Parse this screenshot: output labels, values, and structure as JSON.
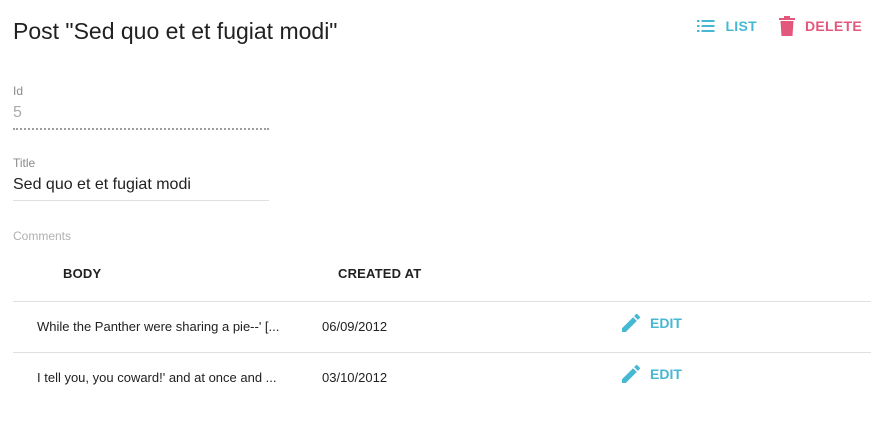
{
  "header": {
    "title": "Post \"Sed quo et et fugiat modi\"",
    "list_label": "LIST",
    "delete_label": "DELETE"
  },
  "fields": {
    "id": {
      "label": "Id",
      "value": "5"
    },
    "title": {
      "label": "Title",
      "value": "Sed quo et et fugiat modi"
    }
  },
  "comments": {
    "label": "Comments",
    "columns": {
      "body": "BODY",
      "created_at": "CREATED AT"
    },
    "rows": [
      {
        "body": "While the Panther were sharing a pie--' [...",
        "created_at": "06/09/2012",
        "edit_label": "EDIT"
      },
      {
        "body": "I tell you, you coward!' and at once and ...",
        "created_at": "03/10/2012",
        "edit_label": "EDIT"
      }
    ]
  },
  "colors": {
    "accent": "#47b8d3",
    "danger": "#e4577d"
  },
  "icons": {
    "list": "list-icon",
    "delete": "trash-icon",
    "edit": "pencil-icon"
  }
}
